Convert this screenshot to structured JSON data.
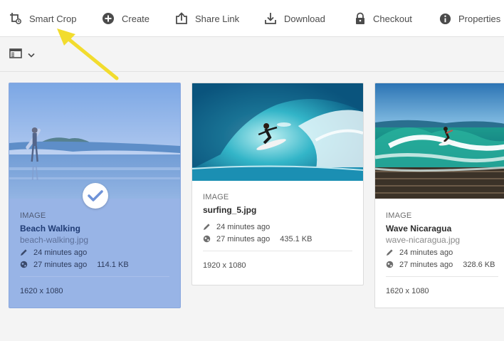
{
  "toolbar": {
    "items": [
      {
        "label": "Smart Crop",
        "icon": "smart-crop-icon"
      },
      {
        "label": "Create",
        "icon": "plus-circle-icon"
      },
      {
        "label": "Share Link",
        "icon": "share-icon"
      },
      {
        "label": "Download",
        "icon": "download-icon"
      },
      {
        "label": "Checkout",
        "icon": "lock-icon"
      },
      {
        "label": "Properties",
        "icon": "info-icon"
      }
    ]
  },
  "viewbar": {
    "view_icon": "card-view-icon"
  },
  "cards": [
    {
      "type": "IMAGE",
      "title": "Beach Walking",
      "filename": "beach-walking.jpg",
      "modified": "24 minutes ago",
      "published": "27 minutes ago",
      "size": "114.1 KB",
      "dimensions": "1620 x 1080",
      "selected": true
    },
    {
      "type": "IMAGE",
      "title": "surfing_5.jpg",
      "modified": "24 minutes ago",
      "published": "27 minutes ago",
      "size": "435.1 KB",
      "dimensions": "1920 x 1080",
      "selected": false
    },
    {
      "type": "IMAGE",
      "title": "Wave Nicaragua",
      "filename": "wave-nicaragua.jpg",
      "modified": "24 minutes ago",
      "published": "27 minutes ago",
      "size": "328.6 KB",
      "dimensions": "1620 x 1080",
      "selected": false
    }
  ],
  "colors": {
    "selection": "#98b4e6",
    "annotation_arrow": "#f5e03a",
    "text": "#4b4b4b"
  }
}
